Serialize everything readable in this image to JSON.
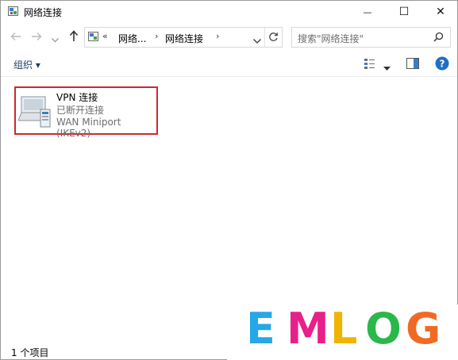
{
  "window": {
    "title": "网络连接",
    "minimize_glyph": "—",
    "maximize_glyph": "☐",
    "close_glyph": "✕"
  },
  "address_bar": {
    "overflow": "«",
    "crumbs": [
      "网络...",
      "网络连接"
    ],
    "separator": "›"
  },
  "search": {
    "placeholder": "搜索\"网络连接\""
  },
  "toolbar": {
    "organize_label": "组织 ▾"
  },
  "items": [
    {
      "name": "VPN 连接",
      "status": "已断开连接",
      "device": "WAN Miniport (IKEv2)"
    }
  ],
  "statusbar": {
    "item_count": "1 个项目"
  },
  "watermark": {
    "letters": [
      "E",
      "M",
      "L",
      "O",
      "G"
    ],
    "colors": [
      "#26a7e8",
      "#e8208a",
      "#f0b400",
      "#2bb84a",
      "#f06a24"
    ]
  },
  "icons": {
    "app": "network-connections-icon",
    "back": "back-arrow-icon",
    "forward": "forward-arrow-icon",
    "recent": "chevron-down-icon",
    "up": "up-arrow-icon",
    "refresh": "refresh-icon",
    "search": "search-icon",
    "view": "view-options-icon",
    "preview": "preview-pane-icon",
    "help": "help-icon",
    "vpn": "vpn-connection-icon"
  }
}
